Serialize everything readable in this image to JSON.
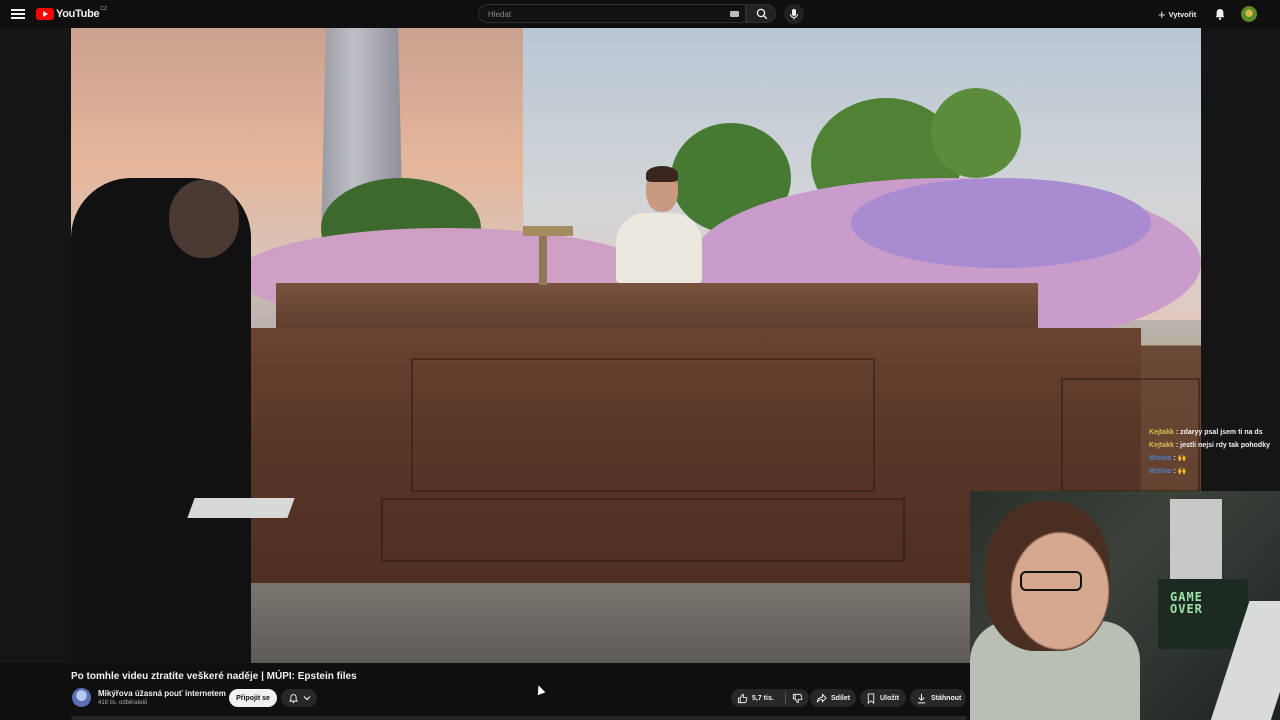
{
  "header": {
    "logo_text": "YouTube",
    "logo_country": "CZ",
    "search_placeholder": "Hledat",
    "create_label": "Vytvořit"
  },
  "video": {
    "title": "Po tomhle videu ztratíte veškeré naděje | MÚPI: Epstein files"
  },
  "channel": {
    "name": "Mikýřova úžasná pouť internetem",
    "subscribers": "418 tis. odběratelů",
    "join_label": "Připojit se"
  },
  "actions": {
    "likes": "5,7 tis.",
    "share_label": "Sdílet",
    "save_label": "Uložit",
    "download_label": "Stáhnout"
  },
  "chat": [
    {
      "user": "Kejtakk",
      "text": " : zdaryy psal jsem ti na ds",
      "user_color": "#e0bd4d"
    },
    {
      "user": "Kejtakk",
      "text": " : jestli nejsi rdy tak pohodky",
      "user_color": "#e0bd4d"
    },
    {
      "user": "Mrzloo",
      "text": " : 🙌",
      "user_color": "#4d7ec9"
    },
    {
      "user": "Mrzloo",
      "text": " : 🙌",
      "user_color": "#4d7ec9"
    }
  ],
  "webcam": {
    "sign_text": "GAME\nOVER"
  },
  "colors": {
    "background": "#0f0f0f",
    "brand_red": "#ff0000",
    "pill_bg": "#272727"
  },
  "icons": [
    "menu-icon",
    "youtube-logo",
    "keyboard-icon",
    "search-icon",
    "mic-icon",
    "plus-icon",
    "bell-icon",
    "thumbs-up-icon",
    "thumbs-down-icon",
    "share-icon",
    "save-icon",
    "download-icon",
    "chevron-down-icon"
  ]
}
